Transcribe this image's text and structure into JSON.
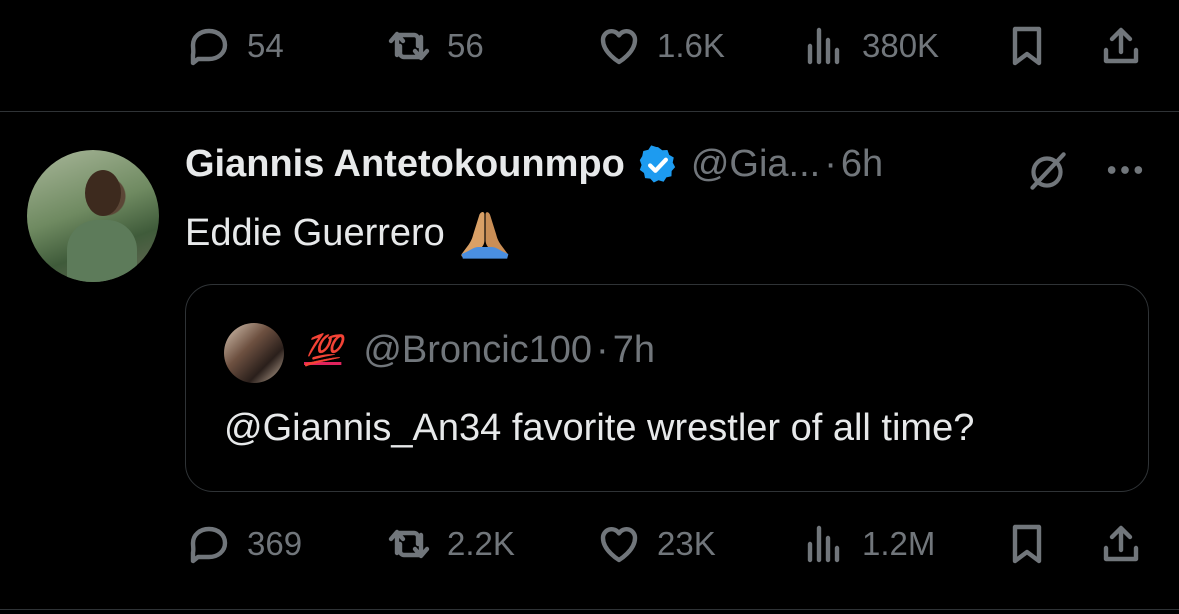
{
  "previous_tweet": {
    "actions": {
      "replies": "54",
      "retweets": "56",
      "likes": "1.6K",
      "views": "380K"
    }
  },
  "tweet": {
    "display_name": "Giannis Antetokounmpo",
    "handle": "@Gia...",
    "separator": "·",
    "time": "6h",
    "text": "Eddie Guerrero",
    "emoji": "folded-hands",
    "quote": {
      "badge": "💯",
      "handle": "@Broncic100",
      "separator": "·",
      "time": "7h",
      "text": "@Giannis_An34 favorite wrestler of all time?"
    },
    "actions": {
      "replies": "369",
      "retweets": "2.2K",
      "likes": "23K",
      "views": "1.2M"
    }
  },
  "colors": {
    "background": "#000000",
    "text": "#e7e9ea",
    "muted": "#71767b",
    "border": "#2f3336",
    "verified": "#1d9bf0"
  }
}
